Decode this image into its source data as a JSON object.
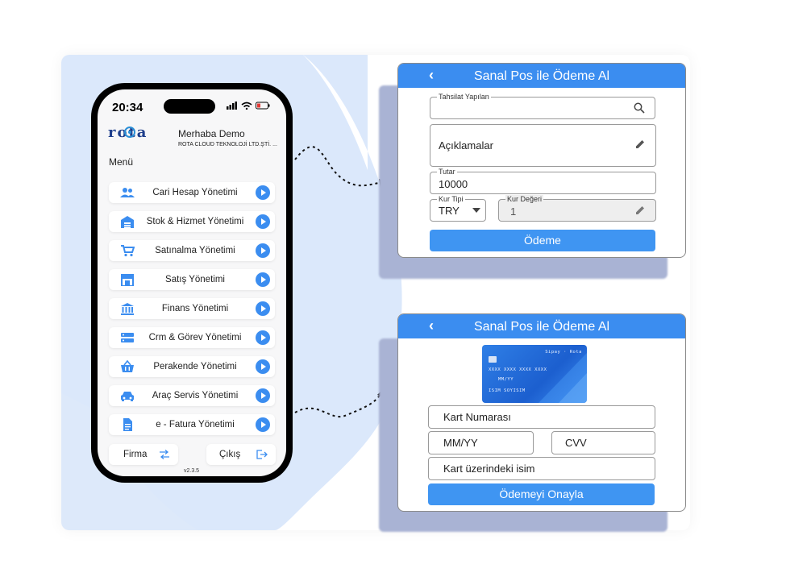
{
  "phone": {
    "time": "20:34",
    "logo_text": "rota",
    "greeting": "Merhaba Demo",
    "company": "ROTA CLOUD TEKNOLOJİ LTD.ŞTİ. ...",
    "menu_title": "Menü",
    "menu_items": [
      {
        "label": "Cari Hesap Yönetimi",
        "icon": "users-icon"
      },
      {
        "label": "Stok & Hizmet Yönetimi",
        "icon": "warehouse-icon"
      },
      {
        "label": "Satınalma Yönetimi",
        "icon": "cart-icon"
      },
      {
        "label": "Satış Yönetimi",
        "icon": "store-icon"
      },
      {
        "label": "Finans Yönetimi",
        "icon": "bank-icon"
      },
      {
        "label": "Crm & Görev Yönetimi",
        "icon": "server-icon"
      },
      {
        "label": "Perakende Yönetimi",
        "icon": "basket-icon"
      },
      {
        "label": "Araç Servis Yönetimi",
        "icon": "car-icon"
      },
      {
        "label": "e - Fatura Yönetimi",
        "icon": "document-icon"
      }
    ],
    "firma_label": "Firma",
    "cikis_label": "Çıkış",
    "version": "v2.3.5"
  },
  "panel1": {
    "title": "Sanal Pos ile Ödeme Al",
    "tahsilat_label": "Tahsilat Yapılan",
    "tahsilat_value": "",
    "aciklama_placeholder": "Açıklamalar",
    "tutar_label": "Tutar",
    "tutar_value": "10000",
    "kur_tipi_label": "Kur Tipi",
    "kur_tipi_value": "TRY",
    "kur_degeri_label": "Kur Değeri",
    "kur_degeri_value": "1",
    "pay_button": "Ödeme"
  },
  "panel2": {
    "title": "Sanal Pos ile Ödeme Al",
    "card": {
      "brand": "Sipay · Rota",
      "number": "XXXX XXXX XXXX XXXX",
      "expiry": "MM/YY",
      "holder": "ISIM SOYISIM"
    },
    "card_number_placeholder": "Kart Numarası",
    "expiry_placeholder": "MM/YY",
    "cvv_placeholder": "CVV",
    "name_placeholder": "Kart üzerindeki isim",
    "confirm_button": "Ödemeyi Onayla"
  },
  "colors": {
    "accent": "#3b8df0",
    "bg_blob": "#dbe9fb",
    "logo": "#1f3f8c"
  }
}
